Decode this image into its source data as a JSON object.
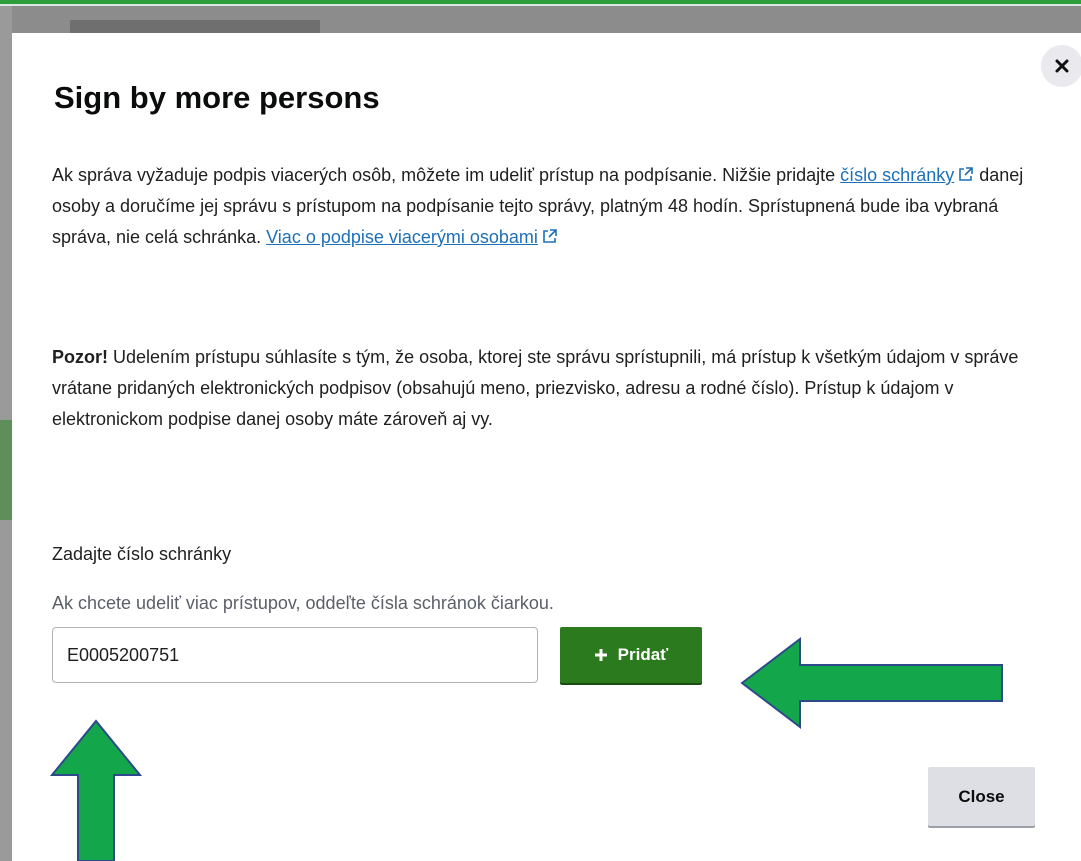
{
  "dialog": {
    "title": "Sign by more persons",
    "close_x_label": "×",
    "p1": {
      "t1": "Ak správa vyžaduje podpis viacerých osôb, môžete im udeliť prístup na podpísanie. Nižšie pridajte ",
      "link1": "číslo schránky",
      "t2": " danej osoby a doručíme jej správu s prístupom na podpísanie tejto správy, platným 48 hodín. Sprístupnená bude iba vybraná správa, nie celá schránka. ",
      "link2": "Viac o podpise viacerými osobami"
    },
    "p2": {
      "bold": "Pozor!",
      "text": " Udelením prístupu súhlasíte s tým, že osoba, ktorej ste správu sprístupnili, má prístup k všetkým údajom v správe vrátane pridaných elektronických podpisov (obsahujú meno, priezvisko, adresu a rodné číslo). Prístup k údajom v elektronickom podpise danej osoby máte zároveň aj vy."
    },
    "field_label": "Zadajte číslo schránky",
    "field_hint": "Ak chcete udeliť viac prístupov, oddeľte čísla schránok čiarkou.",
    "input_value": "E0005200751",
    "add_button_label": "Pridať",
    "close_button_label": "Close"
  },
  "colors": {
    "accent_green": "#2b7a1e",
    "annotation_arrow_fill": "#13a64a",
    "annotation_arrow_stroke": "#2c4a8a",
    "link_blue": "#1d70b8"
  },
  "icons": {
    "close": "close-icon",
    "external_link": "external-link-icon",
    "plus": "plus-icon"
  }
}
